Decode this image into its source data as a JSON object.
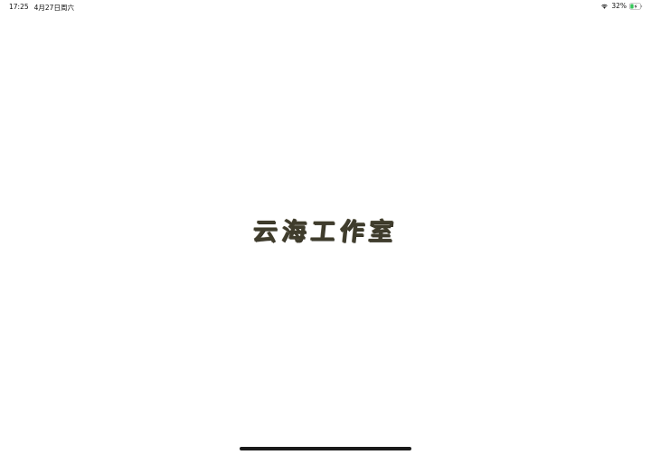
{
  "status_bar": {
    "time": "17:25",
    "date": "4月27日周六",
    "battery_percent": "32%",
    "battery_level": 0.32,
    "charging": true,
    "icons": [
      "wifi-icon",
      "battery-charging-icon"
    ]
  },
  "splash": {
    "logo_text": "云海工作室"
  },
  "colors": {
    "background": "#ffffff",
    "logo_ink": "#3f3c2c",
    "battery_fill": "#34c759",
    "home_indicator": "#1a1a1a"
  }
}
